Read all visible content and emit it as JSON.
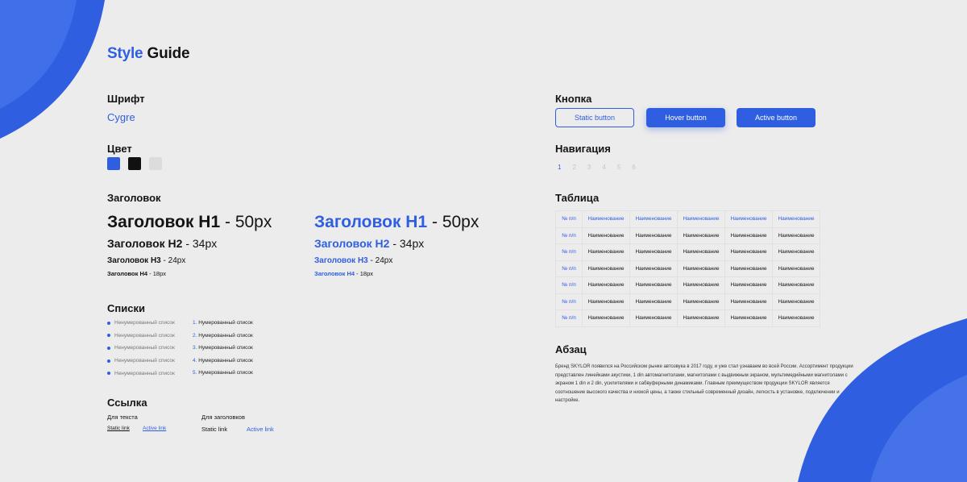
{
  "colors": {
    "accent": "#2f5fe0",
    "black": "#111111",
    "light": "#dddddd"
  },
  "title": {
    "accent": "Style",
    "rest": "Guide"
  },
  "font": {
    "heading": "Шрифт",
    "name": "Cygre"
  },
  "color_section": {
    "heading": "Цвет"
  },
  "headings": {
    "heading": "Заголовок",
    "items": [
      {
        "name": "Заголовок H1",
        "size": "- 50px"
      },
      {
        "name": "Заголовок H2",
        "size": "- 34px"
      },
      {
        "name": "Заголовок H3",
        "size": "- 24px"
      },
      {
        "name": "Заголовок H4",
        "size": "- 18px"
      }
    ]
  },
  "lists": {
    "heading": "Списки",
    "bulleted": [
      "Ненумерованный список",
      "Ненумерованный список",
      "Ненумерованный список",
      "Ненумерованный список",
      "Ненумерованный список"
    ],
    "numbered": [
      {
        "num": "1.",
        "text": "Нумерованный список"
      },
      {
        "num": "2.",
        "text": "Нумерованный список"
      },
      {
        "num": "3.",
        "text": "Нумерованный список"
      },
      {
        "num": "4.",
        "text": "Нумерованный список"
      },
      {
        "num": "5.",
        "text": "Нумерованный список"
      }
    ]
  },
  "links": {
    "heading": "Ссылка",
    "text_label": "Для текста",
    "head_label": "Для заголовков",
    "static": "Static link",
    "active": "Active link"
  },
  "buttons": {
    "heading": "Кнопка",
    "static": "Static button",
    "hover": "Hover button",
    "active": "Active button"
  },
  "navigation": {
    "heading": "Навигация",
    "pages": [
      "1",
      "2",
      "3",
      "4",
      "5",
      "6"
    ]
  },
  "table": {
    "heading": "Таблица",
    "header": [
      "№ п/п",
      "Наименование",
      "Наименование",
      "Наименование",
      "Наименование",
      "Наименование"
    ],
    "rows": [
      [
        "№ п/п",
        "Наименование",
        "Наименование",
        "Наименование",
        "Наименование",
        "Наименование"
      ],
      [
        "№ п/п",
        "Наименование",
        "Наименование",
        "Наименование",
        "Наименование",
        "Наименование"
      ],
      [
        "№ п/п",
        "Наименование",
        "Наименование",
        "Наименование",
        "Наименование",
        "Наименование"
      ],
      [
        "№ п/п",
        "Наименование",
        "Наименование",
        "Наименование",
        "Наименование",
        "Наименование"
      ],
      [
        "№ п/п",
        "Наименование",
        "Наименование",
        "Наименование",
        "Наименование",
        "Наименование"
      ],
      [
        "№ п/п",
        "Наименование",
        "Наименование",
        "Наименование",
        "Наименование",
        "Наименование"
      ]
    ]
  },
  "paragraph": {
    "heading": "Абзац",
    "text": "Бренд SKYLOR появился на Российском рынке автозвука в 2017 году, и уже стал узнаваем во всей России. Ассортимент продукции представлен линейками акустики, 1 din автомагнитолами, магнитолами с выдвижным экраном, мультимедийными магнитолами с экраном 1 din и 2 din, усилителями и сабвуферными динамиками. Главным преимуществом продукции SKYLOR является соотношение высокого качества и низкой цены, а также стильный современный дизайн, легкость в установке, подключении и настройке."
  }
}
